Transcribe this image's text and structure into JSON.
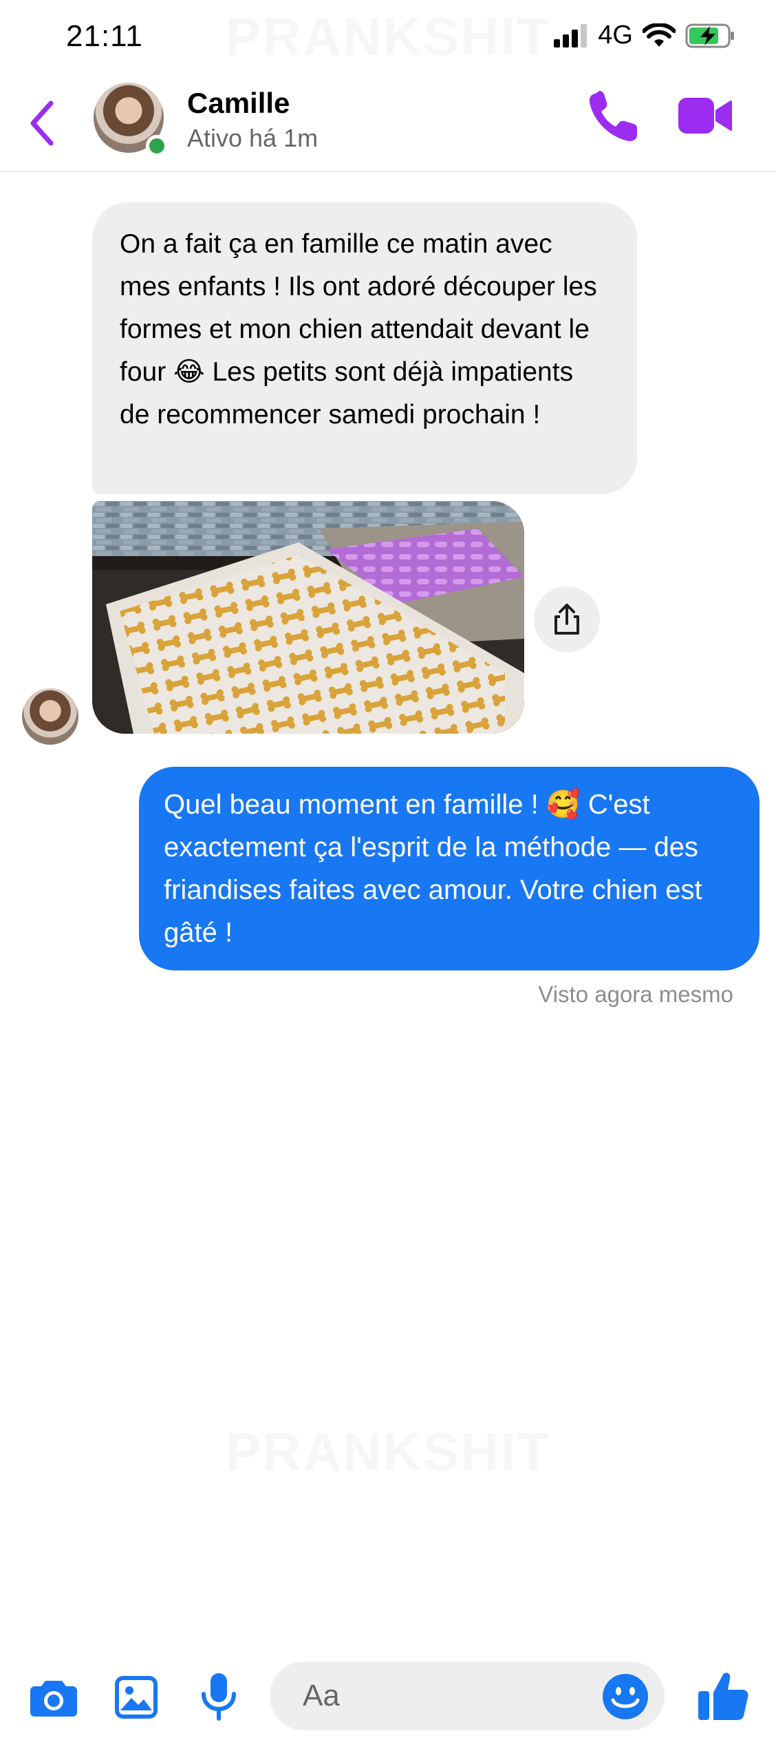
{
  "watermark": "PRANKSHIT",
  "status_bar": {
    "time": "21:11",
    "network": "4G"
  },
  "header": {
    "contact_name": "Camille",
    "contact_status": "Ativo há 1m"
  },
  "messages": {
    "incoming_text": "On a fait ça en famille ce matin avec mes enfants ! Ils ont adoré découper les formes et mon chien attendait devant le four 😂 Les petits sont déjà impatients de recommencer samedi prochain !",
    "outgoing_text": "Quel beau moment en famille ! 🥰 C'est exactement ça l'esprit de la méthode — des friandises faites avec amour. Votre chien est gâté !",
    "seen_label": "Visto agora mesmo"
  },
  "composer": {
    "placeholder": "Aa"
  },
  "colors": {
    "accent_purple": "#9b2cf0",
    "messenger_blue": "#1877f2",
    "online_green": "#31a24c"
  }
}
